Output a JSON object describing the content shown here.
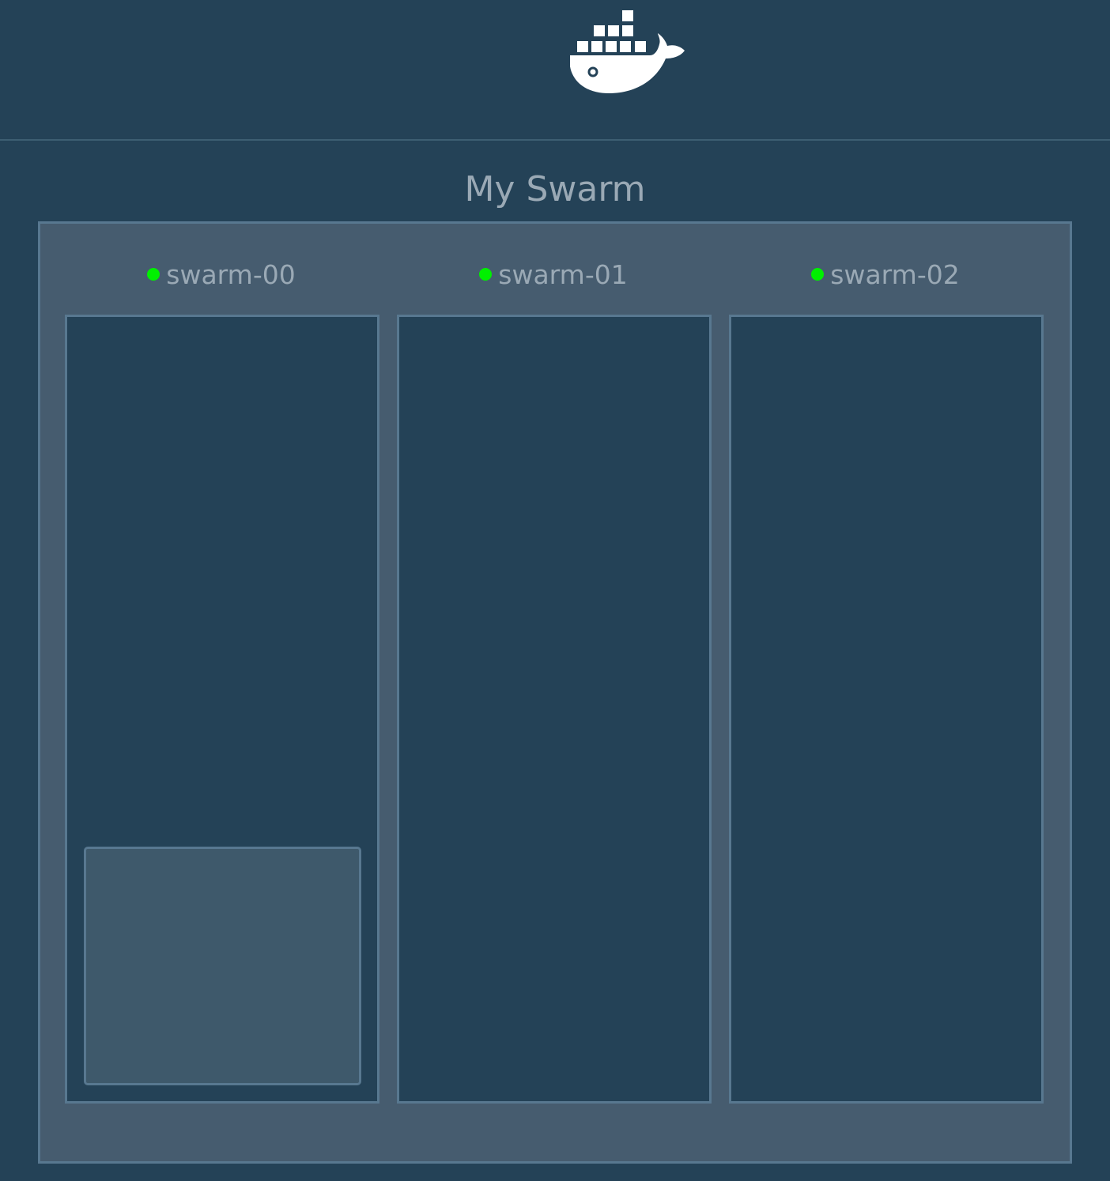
{
  "header": {
    "logo_icon": "docker-whale-icon"
  },
  "title": "My Swarm",
  "colors": {
    "background": "#244257",
    "panel": "#465c6f",
    "border": "#587890",
    "status_up": "#00f000",
    "text": "#9aa9b5"
  },
  "nodes": [
    {
      "name": "swarm-00",
      "status": "up"
    },
    {
      "name": "swarm-01",
      "status": "up"
    },
    {
      "name": "swarm-02",
      "status": "up"
    }
  ]
}
